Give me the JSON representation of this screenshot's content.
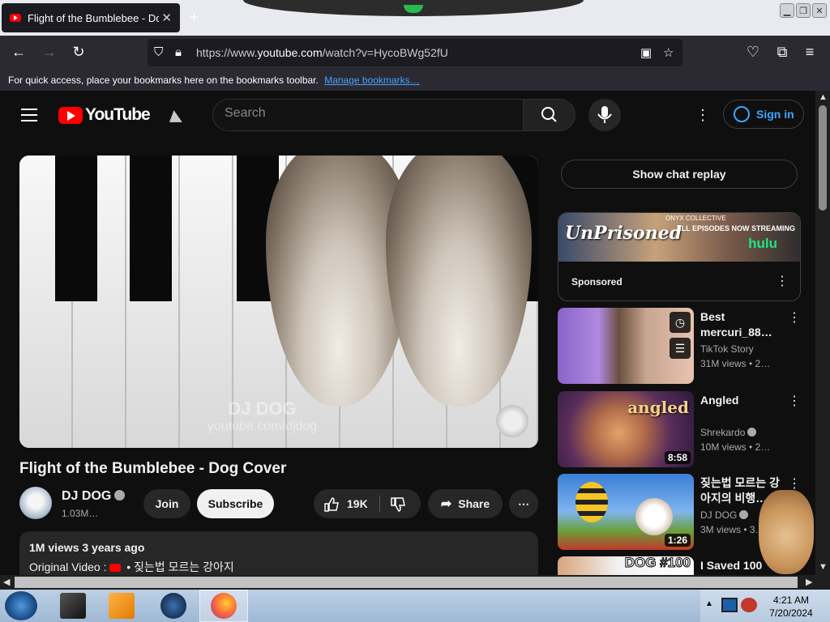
{
  "browser": {
    "tab_title": "Flight of the Bumblebee - Dog Cover",
    "new_tab": "+",
    "close_tab": "✕",
    "url_prefix": "https://www.",
    "url_domain": "youtube.com",
    "url_path": "/watch?v=HycoBWg52fU",
    "bookmarks_message": "For quick access, place your bookmarks here on the bookmarks toolbar.",
    "manage_bookmarks": "Manage bookmarks…"
  },
  "header": {
    "logo_text": "YouTube",
    "search_placeholder": "Search",
    "sign_in": "Sign in"
  },
  "video": {
    "title": "Flight of the Bumblebee - Dog Cover",
    "watermark_title": "DJ DOG",
    "watermark_url": "youtube.com/djdog",
    "channel": "DJ DOG",
    "subscribers": "1.03M…",
    "join": "Join",
    "subscribe": "Subscribe",
    "likes": "19K",
    "share": "Share",
    "views_age": "1M views  3 years ago",
    "original_label": "Original Video :",
    "original_title": "• 짖는법 모르는 강아지"
  },
  "sidebar": {
    "chat_replay": "Show chat replay",
    "ad": {
      "brand": "ONYX COLLECTIVE",
      "title": "UnPrisoned",
      "line": "ALL EPISODES NOW STREAMING",
      "service": "hulu",
      "label": "Sponsored"
    },
    "recommendations": [
      {
        "title": "Best mercuri_88…",
        "channel": "TikTok Story",
        "views": "31M views • 2…",
        "duration": ""
      },
      {
        "title": "Angled",
        "channel": "Shrekardo",
        "views": "10M views • 2…",
        "duration": "8:58",
        "thumb_text": "angled"
      },
      {
        "title": "짖는법 모르는 강아지의 비행…",
        "channel": "DJ DOG",
        "views": "3M views • 3…",
        "duration": "1:26"
      },
      {
        "title": "I Saved 100",
        "channel": "",
        "views": "",
        "duration": "",
        "thumb_text": "DOG #100"
      }
    ]
  },
  "taskbar": {
    "time": "4:21 AM",
    "date": "7/20/2024"
  },
  "colors": {
    "yt_red": "#ff0000",
    "link_blue": "#3ea6ff",
    "page_bg": "#0f0f0f",
    "hulu_green": "#1ce783"
  }
}
